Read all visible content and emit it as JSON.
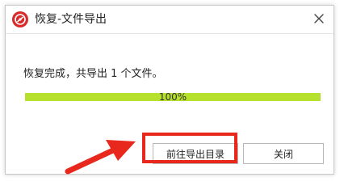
{
  "window": {
    "title": "恢复-文件导出",
    "app_icon": "app-logo-icon",
    "close_icon": "close-icon"
  },
  "content": {
    "message": "恢复完成，共导出 1 个文件。",
    "progress": {
      "value": 1.0,
      "label": "100%",
      "fill_color": "#b5e02b"
    }
  },
  "buttons": {
    "open_folder_label": "前往导出目录",
    "close_label": "关闭"
  },
  "annotation": {
    "highlight_color": "#e8271d",
    "arrow_color": "#e8271d"
  }
}
